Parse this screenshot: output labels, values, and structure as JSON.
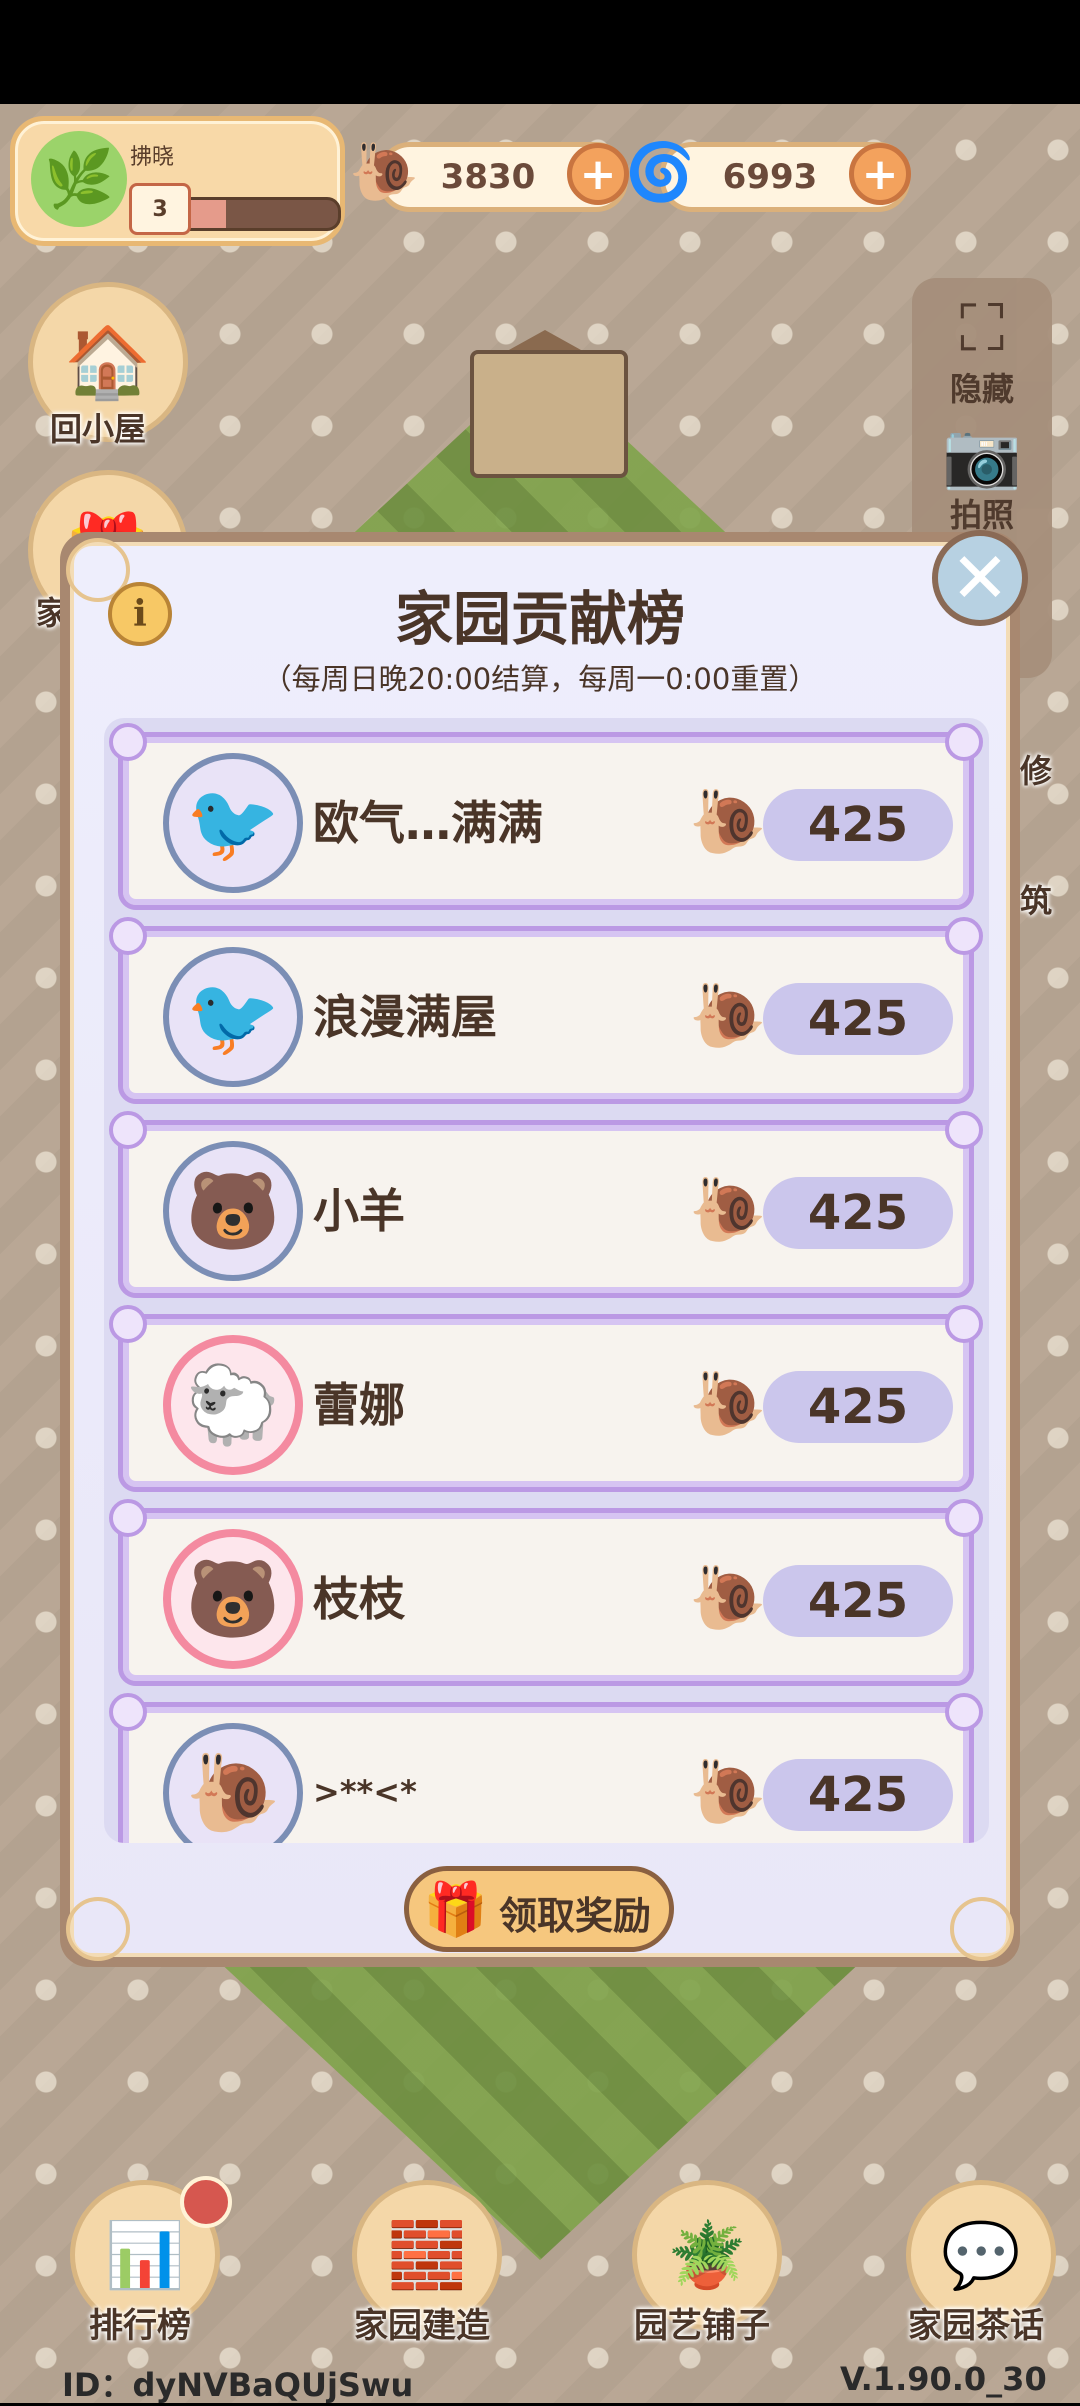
{
  "hud": {
    "player_name": "拂晓",
    "level": "3",
    "level_progress": 0.3,
    "currency_snail": "3830",
    "currency_spiral": "6993",
    "plus": "+"
  },
  "side_left": {
    "home_label": "回小屋",
    "partial_label": "家"
  },
  "side_right": {
    "hide_label": "隐藏",
    "photo_label": "拍照",
    "partial1": "修",
    "partial2": "筑"
  },
  "modal": {
    "info": "i",
    "close": "✕",
    "title": "家园贡献榜",
    "subtitle": "（每周日晚20:00结算，每周一0:00重置）",
    "rows": [
      {
        "name": "欧气…满满",
        "score": "425",
        "avatar": "🐦"
      },
      {
        "name": "浪漫满屋",
        "score": "425",
        "avatar": "🐦"
      },
      {
        "name": "小羊",
        "score": "425",
        "avatar": "🐻"
      },
      {
        "name": "蕾娜",
        "score": "425",
        "avatar": "🐑"
      },
      {
        "name": "枝枝",
        "score": "425",
        "avatar": "🐻"
      },
      {
        "name": ">**<*",
        "score": "425",
        "avatar": "🐌"
      }
    ],
    "reward_label": "领取奖励"
  },
  "nav": {
    "ranking": "排行榜",
    "build": "家园建造",
    "shop": "园艺铺子",
    "chat": "家园茶话"
  },
  "footer": {
    "id": "ID：dyNVBaQUjSwu",
    "version": "V.1.90.0_30"
  }
}
